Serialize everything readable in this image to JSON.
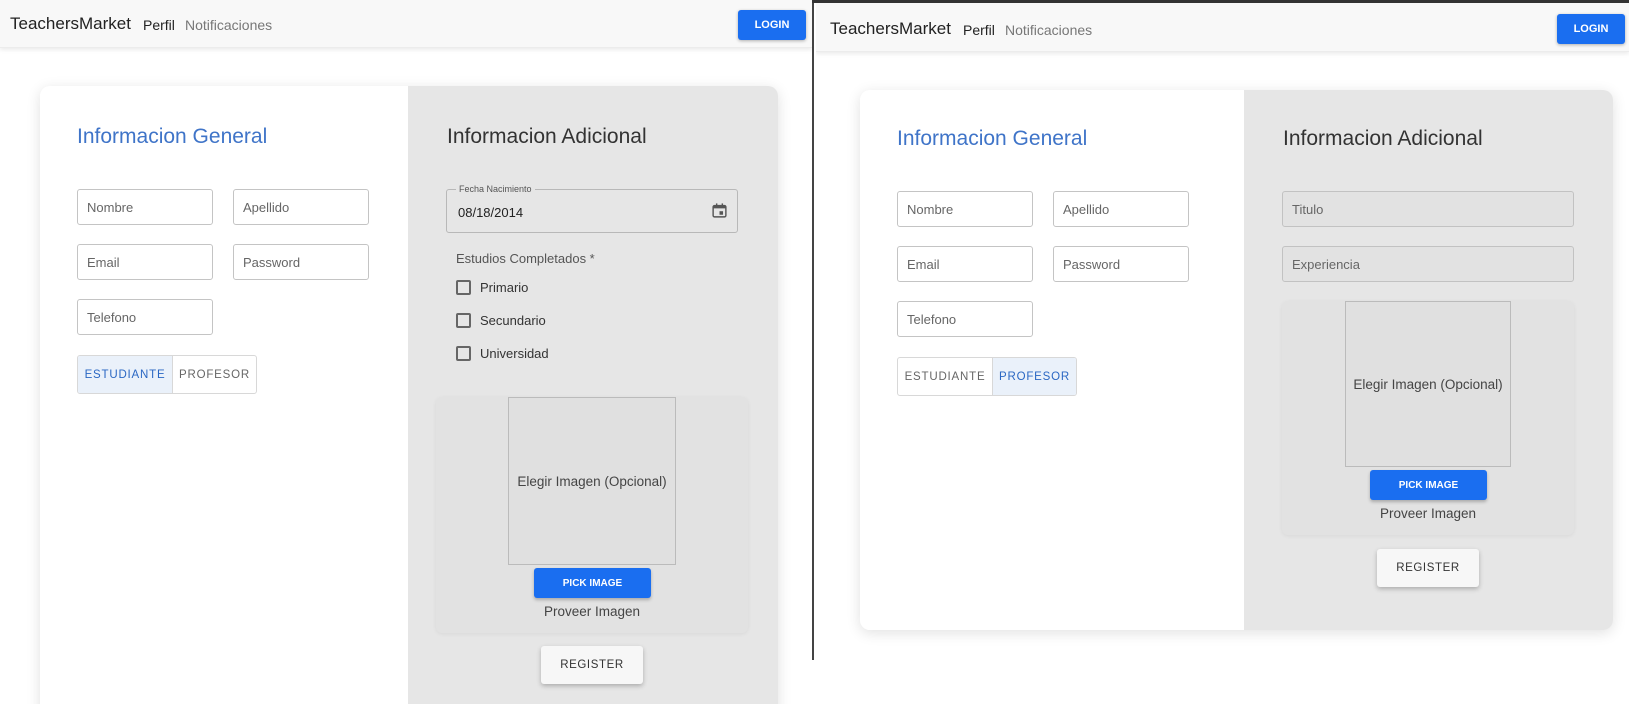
{
  "colors": {
    "accent": "#1a6ef0",
    "title_blue": "#3f74c8",
    "panel_gray": "#e6e6e6"
  },
  "left": {
    "nav": {
      "brand": "TeachersMarket",
      "links": [
        "Perfil",
        "Notificaciones"
      ],
      "login": "LOGIN"
    },
    "general": {
      "title": "Informacion General",
      "placeholders": {
        "nombre": "Nombre",
        "apellido": "Apellido",
        "email": "Email",
        "password": "Password",
        "telefono": "Telefono"
      },
      "role_toggle": {
        "options": [
          "ESTUDIANTE",
          "PROFESOR"
        ],
        "selected": "ESTUDIANTE"
      }
    },
    "additional": {
      "title": "Informacion Adicional",
      "date": {
        "label": "Fecha Nacimiento",
        "value": "08/18/2014",
        "icon": "calendar-icon"
      },
      "studies": {
        "label": "Estudios Completados *",
        "options": [
          "Primario",
          "Secundario",
          "Universidad"
        ]
      },
      "image": {
        "placeholder": "Elegir Imagen (Opcional)",
        "button": "PICK IMAGE",
        "caption": "Proveer Imagen"
      },
      "register": "REGISTER"
    }
  },
  "right": {
    "nav": {
      "brand": "TeachersMarket",
      "links": [
        "Perfil",
        "Notificaciones"
      ],
      "login": "LOGIN"
    },
    "general": {
      "title": "Informacion General",
      "placeholders": {
        "nombre": "Nombre",
        "apellido": "Apellido",
        "email": "Email",
        "password": "Password",
        "telefono": "Telefono"
      },
      "role_toggle": {
        "options": [
          "ESTUDIANTE",
          "PROFESOR"
        ],
        "selected": "PROFESOR"
      }
    },
    "additional": {
      "title": "Informacion Adicional",
      "placeholders": {
        "titulo": "Titulo",
        "experiencia": "Experiencia"
      },
      "image": {
        "placeholder": "Elegir Imagen (Opcional)",
        "button": "PICK IMAGE",
        "caption": "Proveer Imagen"
      },
      "register": "REGISTER"
    }
  }
}
